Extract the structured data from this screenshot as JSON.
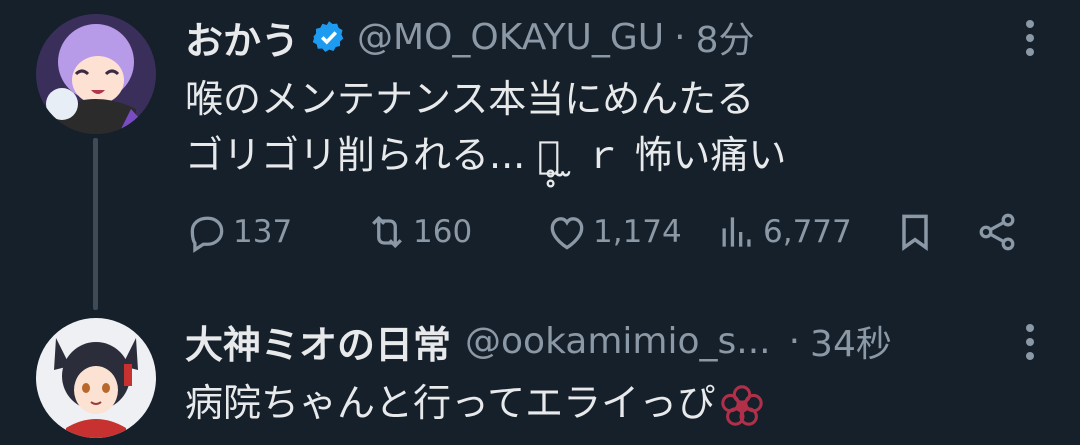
{
  "tweet1": {
    "name": "おかう",
    "handle": "@MO_OKAYU_GU",
    "separator": "·",
    "time": "8分",
    "line1": "喉のメンテナンス本当にめんたる",
    "line2": "ゴリゴリ削られる... ｒ̥̥ ̫ ｒ 怖い痛い",
    "stats": {
      "replies": "137",
      "reposts": "160",
      "likes": "1,174",
      "views": "6,777"
    }
  },
  "tweet2": {
    "name": "大神ミオの日常",
    "handle": "@ookamimio_s...",
    "separator": "·",
    "time": "34秒",
    "text": "病院ちゃんと行ってエライっぴ"
  },
  "colors": {
    "background": "#15202b",
    "text": "#e7e9ea",
    "muted": "#8b98a5",
    "verified": "#1d9bf0",
    "thread_line": "#3e4a55"
  },
  "icons": [
    "verified-badge-icon",
    "more-icon",
    "reply-icon",
    "repost-icon",
    "like-icon",
    "views-icon",
    "bookmark-icon",
    "share-icon"
  ]
}
